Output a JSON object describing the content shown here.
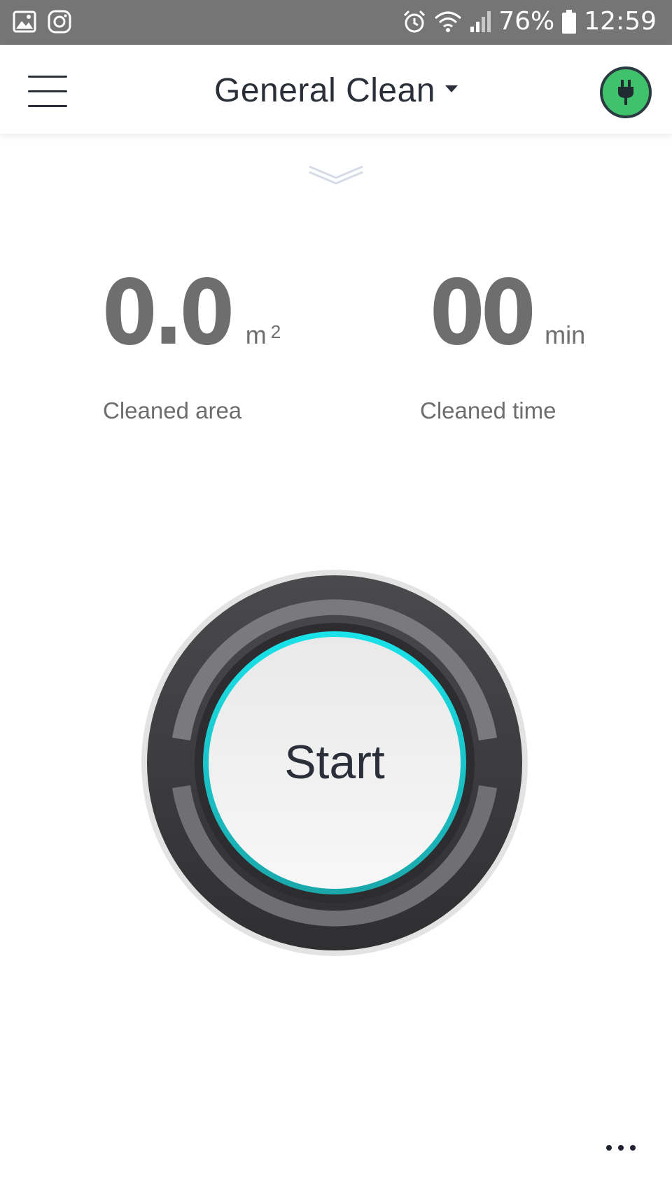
{
  "status_bar": {
    "battery": "76%",
    "time": "12:59",
    "icons": [
      "gallery-icon",
      "instagram-icon",
      "alarm-icon",
      "wifi-icon",
      "signal-icon",
      "battery-icon"
    ]
  },
  "app_bar": {
    "title": "General Clean",
    "icons": [
      "menu-icon",
      "caret-down-icon",
      "plug-icon"
    ],
    "colors": {
      "charging": "#3fc26b"
    }
  },
  "stats": {
    "area": {
      "value": "0.0",
      "unit": "m",
      "unit_superscript": "2",
      "label": "Cleaned area"
    },
    "time": {
      "value": "00",
      "unit": "min",
      "label": "Cleaned time"
    }
  },
  "main": {
    "start_label": "Start",
    "accent_color": "#19e3ea"
  },
  "footer": {
    "icons": [
      "more-icon"
    ]
  }
}
